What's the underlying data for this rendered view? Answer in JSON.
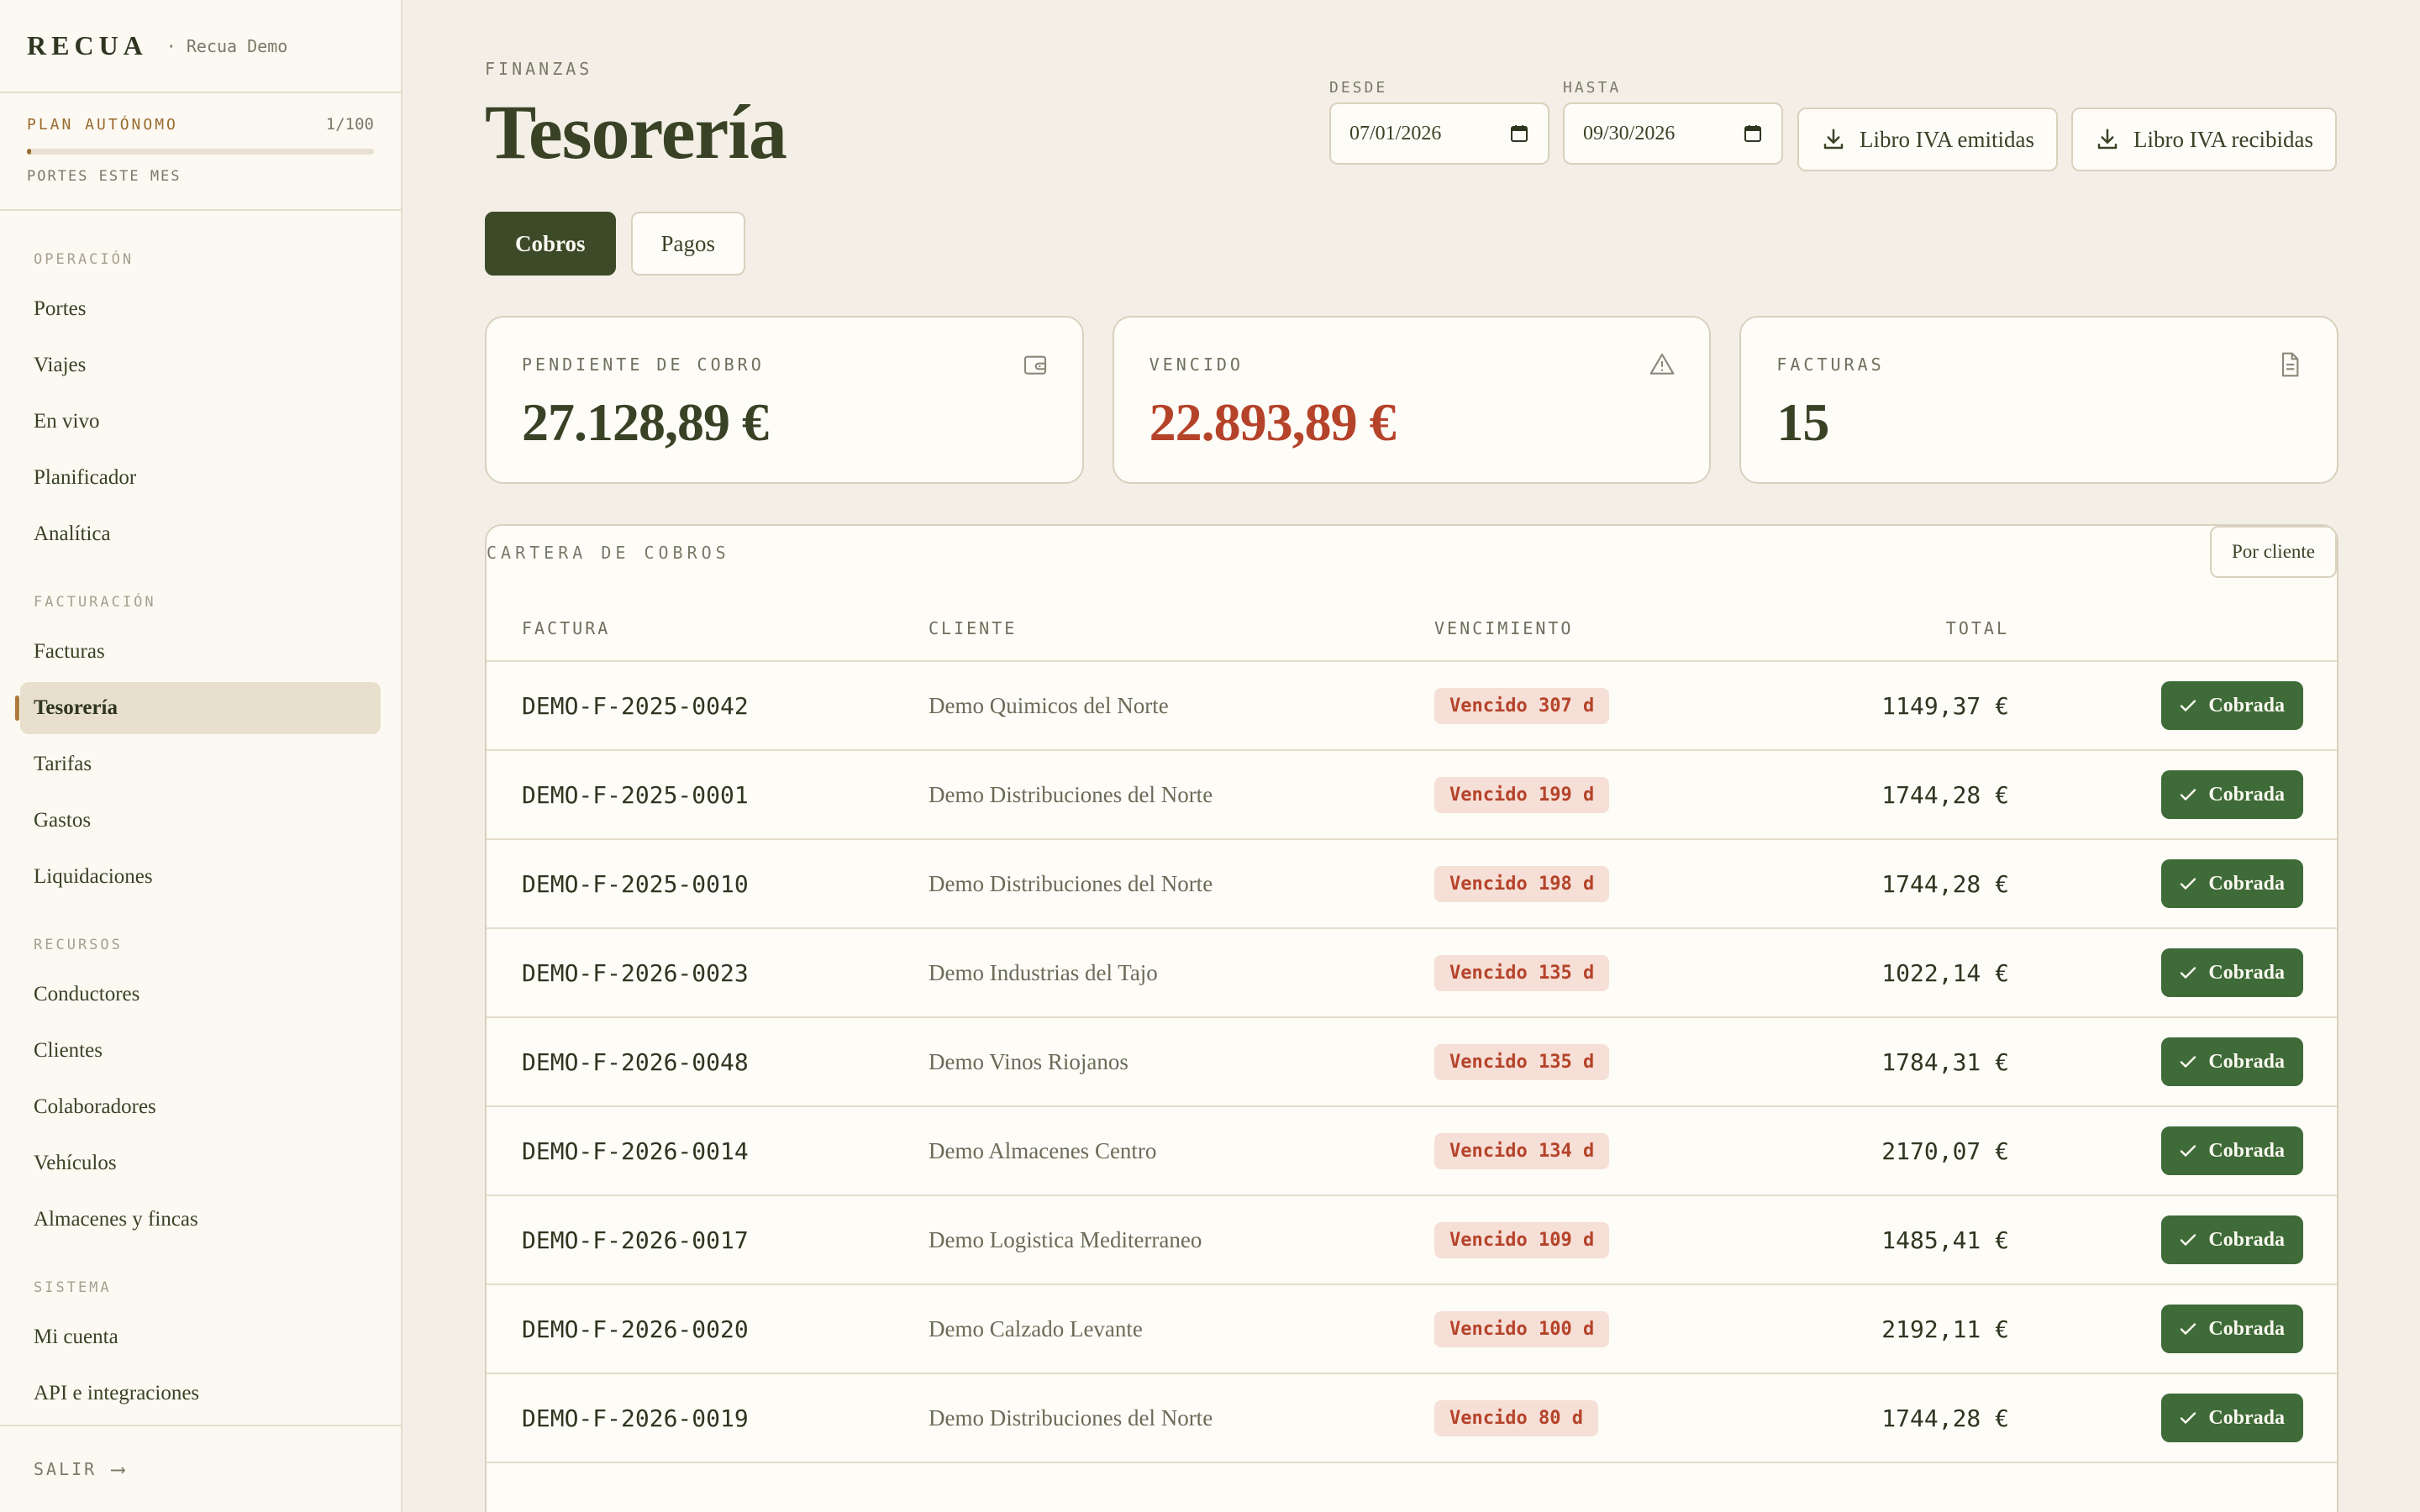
{
  "sidebar": {
    "brand": "RECUA",
    "workspace": "· Recua Demo",
    "plan": {
      "name": "PLAN AUTÓNOMO",
      "count": "1/100",
      "used": 1,
      "limit": 100,
      "sub": "PORTES ESTE MES"
    },
    "sections": [
      {
        "title": "OPERACIÓN",
        "items": [
          "Portes",
          "Viajes",
          "En vivo",
          "Planificador",
          "Analítica"
        ]
      },
      {
        "title": "FACTURACIÓN",
        "items": [
          "Facturas",
          "Tesorería",
          "Tarifas",
          "Gastos",
          "Liquidaciones"
        ]
      },
      {
        "title": "RECURSOS",
        "items": [
          "Conductores",
          "Clientes",
          "Colaboradores",
          "Vehículos",
          "Almacenes y fincas"
        ]
      },
      {
        "title": "SISTEMA",
        "items": [
          "Mi cuenta",
          "API e integraciones"
        ]
      }
    ],
    "active_item": "Tesorería",
    "logout": "SALIR",
    "logout_arrow": "⟶"
  },
  "header": {
    "kicker": "FINANZAS",
    "title": "Tesorería",
    "desde_label": "DESDE",
    "desde_value": "07/01/2026",
    "hasta_label": "HASTA",
    "hasta_value": "09/30/2026",
    "btn_emitidas": "Libro IVA emitidas",
    "btn_recibidas": "Libro IVA recibidas"
  },
  "tabs": {
    "cobros": "Cobros",
    "pagos": "Pagos",
    "active": "Cobros"
  },
  "cards": {
    "pendiente": {
      "label": "PENDIENTE DE COBRO",
      "value": "27.128,89 €",
      "icon": "wallet-icon"
    },
    "vencido": {
      "label": "VENCIDO",
      "value": "22.893,89 €",
      "icon": "warning-icon"
    },
    "facturas": {
      "label": "FACTURAS",
      "value": "15",
      "icon": "document-icon"
    }
  },
  "table": {
    "title": "CARTERA DE COBROS",
    "group_button": "Por cliente",
    "columns": {
      "factura": "FACTURA",
      "cliente": "CLIENTE",
      "vencimiento": "VENCIMIENTO",
      "total": "TOTAL"
    },
    "action_label": "Cobrada",
    "rows": [
      {
        "factura": "DEMO-F-2025-0042",
        "cliente": "Demo Quimicos del Norte",
        "vencimiento": "Vencido 307 d",
        "total": "1149,37 €"
      },
      {
        "factura": "DEMO-F-2025-0001",
        "cliente": "Demo Distribuciones del Norte",
        "vencimiento": "Vencido 199 d",
        "total": "1744,28 €"
      },
      {
        "factura": "DEMO-F-2025-0010",
        "cliente": "Demo Distribuciones del Norte",
        "vencimiento": "Vencido 198 d",
        "total": "1744,28 €"
      },
      {
        "factura": "DEMO-F-2026-0023",
        "cliente": "Demo Industrias del Tajo",
        "vencimiento": "Vencido 135 d",
        "total": "1022,14 €"
      },
      {
        "factura": "DEMO-F-2026-0048",
        "cliente": "Demo Vinos Riojanos",
        "vencimiento": "Vencido 135 d",
        "total": "1784,31 €"
      },
      {
        "factura": "DEMO-F-2026-0014",
        "cliente": "Demo Almacenes Centro",
        "vencimiento": "Vencido 134 d",
        "total": "2170,07 €"
      },
      {
        "factura": "DEMO-F-2026-0017",
        "cliente": "Demo Logistica Mediterraneo",
        "vencimiento": "Vencido 109 d",
        "total": "1485,41 €"
      },
      {
        "factura": "DEMO-F-2026-0020",
        "cliente": "Demo Calzado Levante",
        "vencimiento": "Vencido 100 d",
        "total": "2192,11 €"
      },
      {
        "factura": "DEMO-F-2026-0019",
        "cliente": "Demo Distribuciones del Norte",
        "vencimiento": "Vencido 80 d",
        "total": "1744,28 €"
      }
    ]
  },
  "colors": {
    "accent": "#3d4a28",
    "success": "#3f6b38",
    "danger": "#b5432a",
    "plan_accent": "#9a6a2e",
    "background": "#f3efe6"
  }
}
